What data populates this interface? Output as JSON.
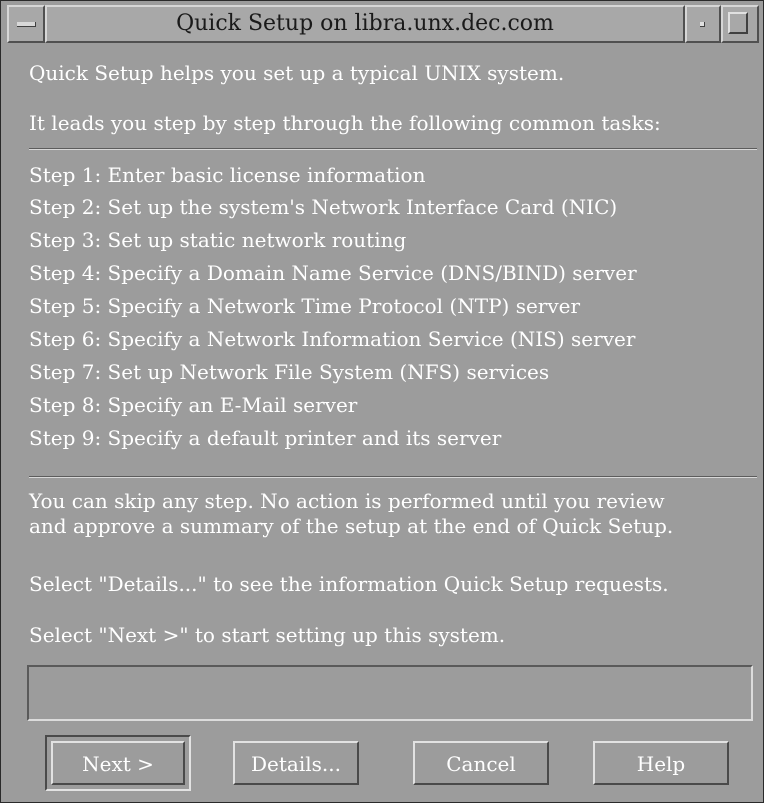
{
  "window": {
    "title": "Quick Setup on libra.unx.dec.com"
  },
  "intro": {
    "line1": "Quick Setup helps you set up a typical UNIX system.",
    "line2": "It leads you step by step through the following common tasks:"
  },
  "steps": [
    "Step 1: Enter basic license information",
    "Step 2: Set up the system's Network Interface Card (NIC)",
    "Step 3: Set up static network routing",
    "Step 4: Specify a Domain Name Service (DNS/BIND) server",
    "Step 5: Specify a Network Time Protocol (NTP) server",
    "Step 6: Specify a Network Information Service (NIS) server",
    "Step 7: Set up Network File System (NFS) services",
    "Step 8: Specify an E-Mail server",
    "Step 9: Specify a default printer and its server"
  ],
  "notes": {
    "skip_line1": "You can skip any step. No action is performed until you review",
    "skip_line2": "and approve a summary of the setup at the end of Quick Setup.",
    "details_hint": "Select \"Details...\" to see the information Quick Setup requests.",
    "next_hint": "Select \"Next >\" to start setting up this system."
  },
  "message_area": {
    "value": ""
  },
  "buttons": {
    "next": "Next >",
    "details": "Details...",
    "cancel": "Cancel",
    "help": "Help"
  },
  "icons": {
    "window_menu": "window-menu-icon",
    "minimize": "minimize-icon",
    "maximize": "maximize-icon"
  },
  "colors": {
    "background": "#9c9c9c",
    "text": "#ffffff",
    "title_text": "#1a1a1a"
  }
}
